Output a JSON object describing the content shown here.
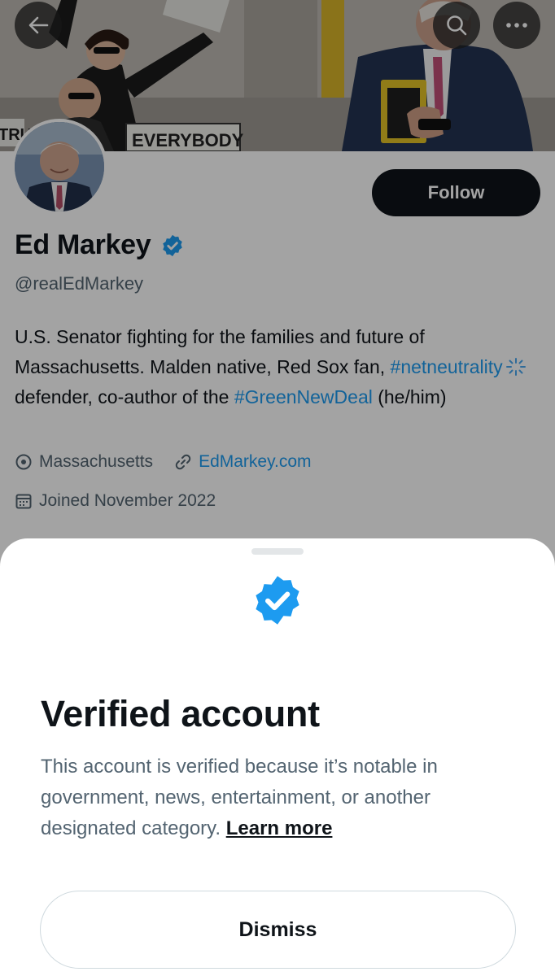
{
  "header": {
    "back_icon": "arrow-left-icon",
    "search_icon": "search-icon",
    "more_icon": "more-horizontal-icon",
    "banner_sign_text": "EVERYBODY",
    "banner_sign_partial": "TRU"
  },
  "profile": {
    "display_name": "Ed Markey",
    "handle": "@realEdMarkey",
    "verified_icon": "verified-badge-icon",
    "follow_label": "Follow",
    "bio": {
      "part1": "U.S. Senator fighting for the families and future of Massachusetts. Malden native, Red Sox fan, ",
      "hashtag1": "#netneutrality",
      "part2": " defender, co-author of the ",
      "hashtag2": "#GreenNewDeal",
      "part3": " (he/him)"
    },
    "location": "Massachusetts",
    "website": "EdMarkey.com",
    "joined": "Joined November 2022"
  },
  "sheet": {
    "title": "Verified account",
    "description": "This account is verified because it’s notable in government, news, entertainment, or another designated category.",
    "learn_more": "Learn more",
    "dismiss_label": "Dismiss"
  },
  "colors": {
    "accent": "#1d9bf0",
    "text_primary": "#0f1419",
    "text_secondary": "#536471",
    "badge_blue": "#1d9bf0"
  }
}
